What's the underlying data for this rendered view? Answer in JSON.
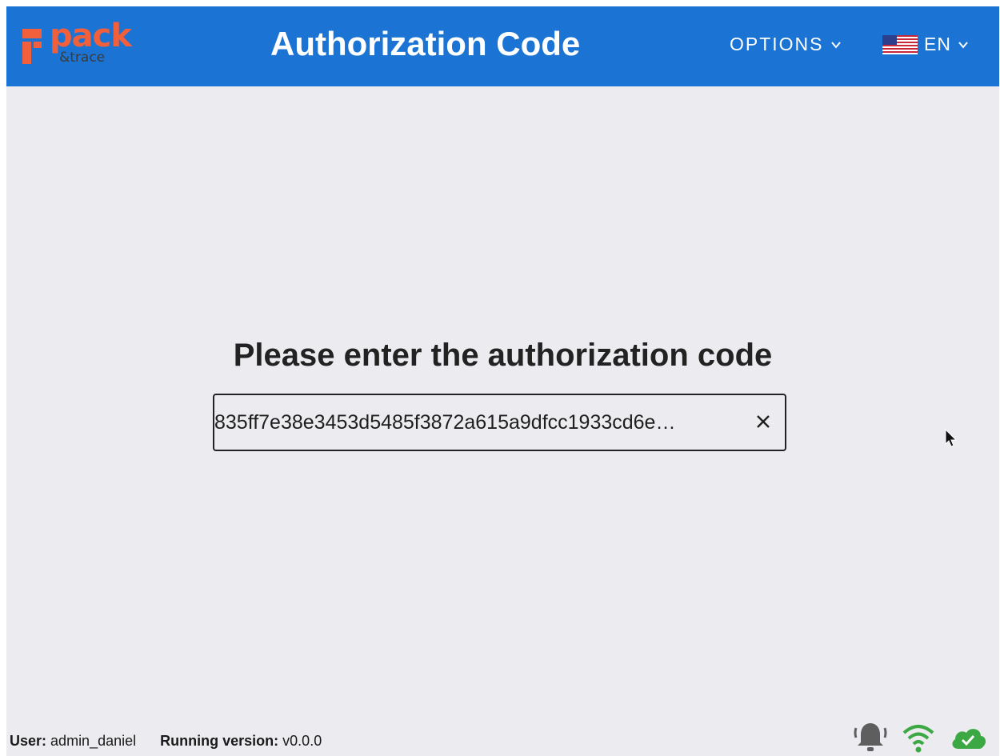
{
  "header": {
    "logo_word": "pack",
    "logo_sub": "&trace",
    "title": "Authorization Code",
    "options_label": "OPTIONS",
    "language_label": "EN",
    "accent_color": "#1b74d4",
    "brand_color": "#f2603b"
  },
  "main": {
    "prompt": "Please enter the authorization code",
    "code_value": "…835ff7e38e3453d5485f3872a615a9dfcc1933cd6e"
  },
  "footer": {
    "user_label": "User:",
    "user_value": "admin_daniel",
    "version_label": "Running version:",
    "version_value": "v0.0.0"
  },
  "status": {
    "icons": [
      "bell-icon",
      "wifi-icon",
      "cloud-check-icon"
    ],
    "ok_color": "#3ca844",
    "bell_color": "#5e5e5e"
  }
}
